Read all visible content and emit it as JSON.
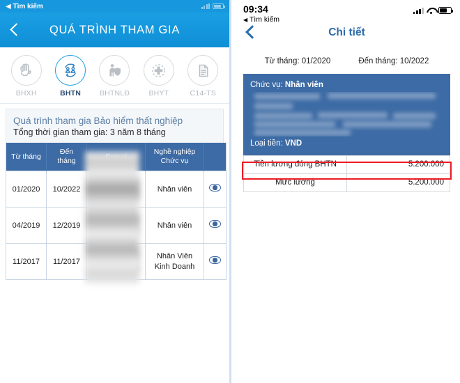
{
  "left": {
    "status_bar": {
      "search_label": "◀ Tìm kiếm"
    },
    "navbar": {
      "title": "QUÁ TRÌNH THAM GIA",
      "back_icon": "chevron-left-icon"
    },
    "tabs": [
      {
        "label": "BHXH",
        "icon": "hands-heart-icon",
        "active": false
      },
      {
        "label": "BHTN",
        "icon": "people-cycle-icon",
        "active": true
      },
      {
        "label": "BHTNLĐ",
        "icon": "worker-shield-icon",
        "active": false
      },
      {
        "label": "BHYT",
        "icon": "medical-cross-icon",
        "active": false
      },
      {
        "label": "C14-TS",
        "icon": "document-icon",
        "active": false
      }
    ],
    "section": {
      "title": "Quá trình tham gia Bảo hiểm thất nghiệp",
      "subtitle": "Tổng thời gian tham gia: 3 năm 8 tháng"
    },
    "table": {
      "headers": [
        "Từ tháng",
        "Đến tháng",
        "Đơn vị",
        "Nghề nghiệp Chức vụ",
        ""
      ],
      "headers_multiline": [
        [
          "Từ tháng"
        ],
        [
          "Đến",
          "tháng"
        ],
        [
          "Đơn vị"
        ],
        [
          "Nghề nghiệp",
          "Chức vụ"
        ],
        [
          ""
        ]
      ],
      "rows": [
        {
          "from": "01/2020",
          "to": "10/2022",
          "unit": "",
          "job": "Nhân viên",
          "job_line2": "",
          "eye_icon": "eye-icon"
        },
        {
          "from": "04/2019",
          "to": "12/2019",
          "unit": "",
          "job": "Nhân viên",
          "job_line2": "",
          "eye_icon": "eye-icon"
        },
        {
          "from": "11/2017",
          "to": "11/2017",
          "unit": "",
          "job": "Nhân Viên",
          "job_line2": "Kinh Doanh",
          "eye_icon": "eye-icon"
        }
      ]
    }
  },
  "right": {
    "status_bar": {
      "time": "09:34",
      "search_label": "Tìm kiếm",
      "search_triangle": "◀",
      "signal_icon": "cellular-signal-icon",
      "wifi_icon": "wifi-icon",
      "battery_icon": "battery-icon"
    },
    "navbar": {
      "title": "Chi tiết",
      "back_icon": "chevron-left-icon"
    },
    "months": {
      "from_label": "Từ tháng: 01/2020",
      "to_label": "Đến tháng: 10/2022"
    },
    "card": {
      "role_label": "Chức vụ:",
      "role_value": "Nhân viên",
      "currency_label": "Loại tiền:",
      "currency_value": "VND"
    },
    "table": {
      "rows": [
        {
          "label": "Tiền lương đóng BHTN",
          "value": "5.200.000",
          "highlighted": true
        },
        {
          "label": "Mức lương",
          "value": "5.200.000",
          "highlighted": false
        }
      ]
    }
  },
  "colors": {
    "header_blue": "#1b9fe3",
    "table_header_blue": "#3d6ba5",
    "accent_blue": "#2b6bab",
    "highlight_red": "#ed1c24",
    "panel_border": "#cfe0f0"
  }
}
